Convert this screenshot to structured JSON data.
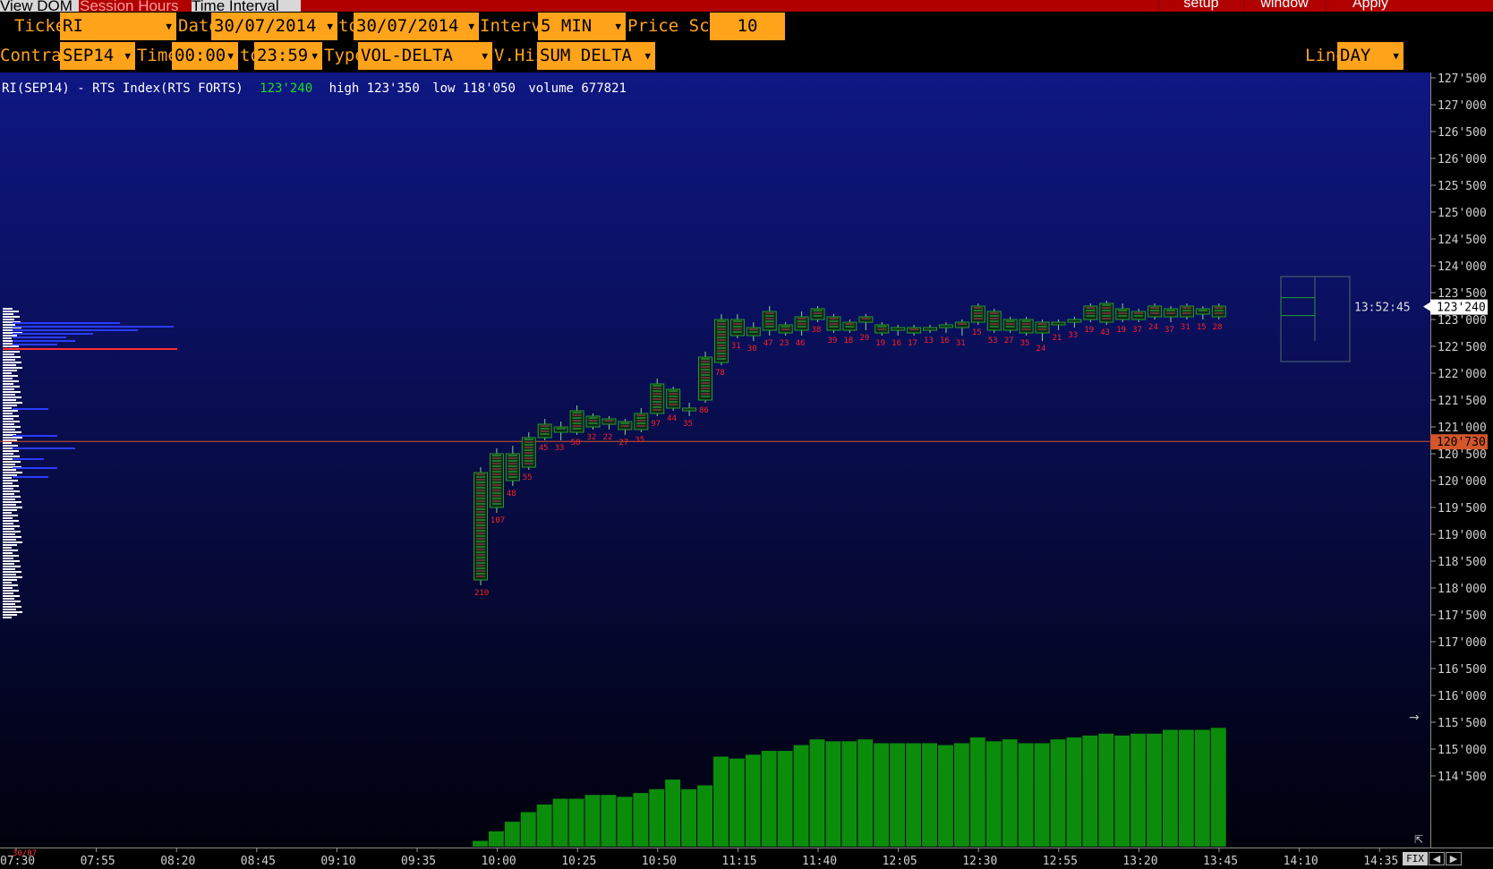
{
  "top_tabs": {
    "view_dom": "View DOM",
    "session_hours": "Session Hours",
    "time_interval": "Time Interval"
  },
  "top_buttons": {
    "setup": "setup",
    "window": "window",
    "apply": "Apply"
  },
  "controls": {
    "ticker_label": "Ticker",
    "ticker_value": "RI",
    "date_label": "Date",
    "date_from": "30/07/2014",
    "to_label": "to",
    "date_to": "30/07/2014",
    "interval_label": "Interval",
    "interval_value": "5 MIN",
    "price_scale_label": "Price Scale",
    "price_scale_value": "10",
    "contract_label": "Contract",
    "contract_value": "SEP14",
    "time_label": "Time",
    "time_from": "00:00",
    "time_to_label": "to",
    "time_to": "23:59",
    "type_label": "Type",
    "type_value": "VOL-DELTA",
    "vhist_label": "V.Hist",
    "vhist_value": "SUM DELTA",
    "line_label": "Line",
    "line_value": "DAY"
  },
  "info": {
    "symbol": "RI(SEP14) - RTS Index(RTS FORTS)",
    "last": "123'240",
    "high": "high 123'350",
    "low": "low 118'050",
    "volume": "volume 677821"
  },
  "markers": {
    "last_price": "123'240",
    "ref_price": "120'730",
    "clock": "13:52:45"
  },
  "colors": {
    "accent": "#ffa31a",
    "topbar": "#b10000",
    "candle_up": "#2a9a2a",
    "count_text": "#ff2020",
    "ref_line": "#d3572a",
    "volume_bar": "#0b8c0b"
  },
  "chart_data": {
    "type": "bar",
    "title": "RI(SEP14) - RTS Index(RTS FORTS)",
    "y_ticks": [
      "127'500",
      "127'000",
      "126'500",
      "126'000",
      "125'500",
      "125'000",
      "124'500",
      "124'000",
      "123'500",
      "123'000",
      "122'500",
      "122'000",
      "121'500",
      "121'000",
      "120'500",
      "120'000",
      "119'500",
      "119'000",
      "118'500",
      "118'000",
      "117'500",
      "117'000",
      "116'500",
      "116'000",
      "115'500",
      "115'000",
      "114'500"
    ],
    "x_ticks": [
      "07:30",
      "07:55",
      "08:20",
      "08:45",
      "09:10",
      "09:35",
      "10:00",
      "10:25",
      "10:50",
      "11:15",
      "11:40",
      "12:05",
      "12:30",
      "12:55",
      "13:20",
      "13:45",
      "14:10",
      "14:35"
    ],
    "date_label": "30/07",
    "ylim": [
      114250,
      127750
    ],
    "candles": [
      {
        "o": 118150,
        "c": 120150,
        "l": 118050,
        "h": 120250,
        "n": "210"
      },
      {
        "o": 119500,
        "c": 120500,
        "l": 119400,
        "h": 120600,
        "n": "107"
      },
      {
        "o": 120000,
        "c": 120500,
        "l": 119900,
        "h": 120650,
        "n": "48"
      },
      {
        "o": 120250,
        "c": 120800,
        "l": 120200,
        "h": 120900,
        "n": "55"
      },
      {
        "o": 120800,
        "c": 121050,
        "l": 120750,
        "h": 121150,
        "n": "45"
      },
      {
        "o": 121000,
        "c": 120900,
        "l": 120750,
        "h": 121100,
        "n": "33"
      },
      {
        "o": 120900,
        "c": 121300,
        "l": 120850,
        "h": 121400,
        "n": "58"
      },
      {
        "o": 121200,
        "c": 121000,
        "l": 120950,
        "h": 121250,
        "n": "32"
      },
      {
        "o": 121050,
        "c": 121150,
        "l": 120950,
        "h": 121200,
        "n": "22"
      },
      {
        "o": 121100,
        "c": 120950,
        "l": 120850,
        "h": 121150,
        "n": "27"
      },
      {
        "o": 120950,
        "c": 121250,
        "l": 120900,
        "h": 121350,
        "n": "35"
      },
      {
        "o": 121250,
        "c": 121800,
        "l": 121200,
        "h": 121900,
        "n": "97"
      },
      {
        "o": 121700,
        "c": 121350,
        "l": 121300,
        "h": 121750,
        "n": "44"
      },
      {
        "o": 121350,
        "c": 121300,
        "l": 121200,
        "h": 121450,
        "n": "35"
      },
      {
        "o": 121500,
        "c": 122300,
        "l": 121450,
        "h": 122400,
        "n": "86"
      },
      {
        "o": 122200,
        "c": 123000,
        "l": 122150,
        "h": 123100,
        "n": "78"
      },
      {
        "o": 123000,
        "c": 122700,
        "l": 122650,
        "h": 123100,
        "n": "31"
      },
      {
        "o": 122700,
        "c": 122850,
        "l": 122600,
        "h": 122950,
        "n": "30"
      },
      {
        "o": 122800,
        "c": 123150,
        "l": 122700,
        "h": 123250,
        "n": "47"
      },
      {
        "o": 122900,
        "c": 122750,
        "l": 122700,
        "h": 122950,
        "n": "23"
      },
      {
        "o": 122800,
        "c": 123050,
        "l": 122700,
        "h": 123150,
        "n": "46"
      },
      {
        "o": 123000,
        "c": 123200,
        "l": 122950,
        "h": 123250,
        "n": "38"
      },
      {
        "o": 123050,
        "c": 122800,
        "l": 122750,
        "h": 123100,
        "n": "39"
      },
      {
        "o": 122800,
        "c": 122950,
        "l": 122750,
        "h": 123000,
        "n": "18"
      },
      {
        "o": 122950,
        "c": 123050,
        "l": 122800,
        "h": 123100,
        "n": "29"
      },
      {
        "o": 122900,
        "c": 122750,
        "l": 122700,
        "h": 122950,
        "n": "19"
      },
      {
        "o": 122800,
        "c": 122850,
        "l": 122700,
        "h": 122900,
        "n": "16"
      },
      {
        "o": 122850,
        "c": 122750,
        "l": 122700,
        "h": 122900,
        "n": "17"
      },
      {
        "o": 122800,
        "c": 122850,
        "l": 122750,
        "h": 122900,
        "n": "13"
      },
      {
        "o": 122850,
        "c": 122900,
        "l": 122750,
        "h": 122950,
        "n": "16"
      },
      {
        "o": 122850,
        "c": 122950,
        "l": 122700,
        "h": 123000,
        "n": "31"
      },
      {
        "o": 122950,
        "c": 123250,
        "l": 122900,
        "h": 123300,
        "n": "15"
      },
      {
        "o": 123150,
        "c": 122800,
        "l": 122750,
        "h": 123200,
        "n": "53"
      },
      {
        "o": 122800,
        "c": 123000,
        "l": 122750,
        "h": 123050,
        "n": "27"
      },
      {
        "o": 123000,
        "c": 122750,
        "l": 122700,
        "h": 123050,
        "n": "35"
      },
      {
        "o": 122750,
        "c": 122950,
        "l": 122600,
        "h": 123000,
        "n": "24"
      },
      {
        "o": 122900,
        "c": 122950,
        "l": 122800,
        "h": 123000,
        "n": "21"
      },
      {
        "o": 122950,
        "c": 123000,
        "l": 122850,
        "h": 123050,
        "n": "33"
      },
      {
        "o": 123000,
        "c": 123250,
        "l": 122950,
        "h": 123300,
        "n": "19"
      },
      {
        "o": 123300,
        "c": 122950,
        "l": 122900,
        "h": 123350,
        "n": "43"
      },
      {
        "o": 123000,
        "c": 123200,
        "l": 122950,
        "h": 123300,
        "n": "19"
      },
      {
        "o": 123150,
        "c": 123000,
        "l": 122950,
        "h": 123200,
        "n": "37"
      },
      {
        "o": 123050,
        "c": 123250,
        "l": 123000,
        "h": 123300,
        "n": "24"
      },
      {
        "o": 123200,
        "c": 123050,
        "l": 122950,
        "h": 123250,
        "n": "37"
      },
      {
        "o": 123050,
        "c": 123250,
        "l": 123000,
        "h": 123300,
        "n": "31"
      },
      {
        "o": 123200,
        "c": 123100,
        "l": 123000,
        "h": 123250,
        "n": "15"
      },
      {
        "o": 123050,
        "c": 123250,
        "l": 123000,
        "h": 123300,
        "n": "28"
      }
    ],
    "cum_delta": [
      3,
      8,
      13,
      18,
      22,
      25,
      25,
      27,
      27,
      26,
      28,
      30,
      35,
      30,
      32,
      47,
      46,
      48,
      50,
      50,
      53,
      56,
      55,
      55,
      56,
      54,
      54,
      54,
      54,
      53,
      54,
      57,
      55,
      56,
      54,
      54,
      56,
      57,
      58,
      59,
      58,
      59,
      59,
      61,
      61,
      61,
      62
    ],
    "profile_note": ""
  }
}
